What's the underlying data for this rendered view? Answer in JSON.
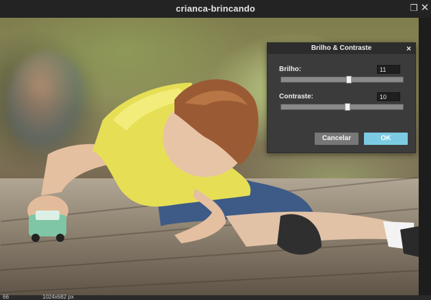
{
  "window": {
    "title": "crianca-brincando"
  },
  "dialog": {
    "title": "Brilho & Contraste",
    "brightness": {
      "label": "Brilho:",
      "value": "11",
      "level": 0.55
    },
    "contrast": {
      "label": "Contraste:",
      "value": "10",
      "level": 0.54
    },
    "cancel_label": "Cancelar",
    "ok_label": "OK"
  },
  "status": {
    "zoom": "66",
    "info": "1024x682 px"
  },
  "colors": {
    "accent": "#7ccbe3",
    "dialog_bg": "#3b3b3b"
  },
  "icons": {
    "restore": "restore-icon",
    "close": "close-icon",
    "dialog_close": "close-icon"
  }
}
